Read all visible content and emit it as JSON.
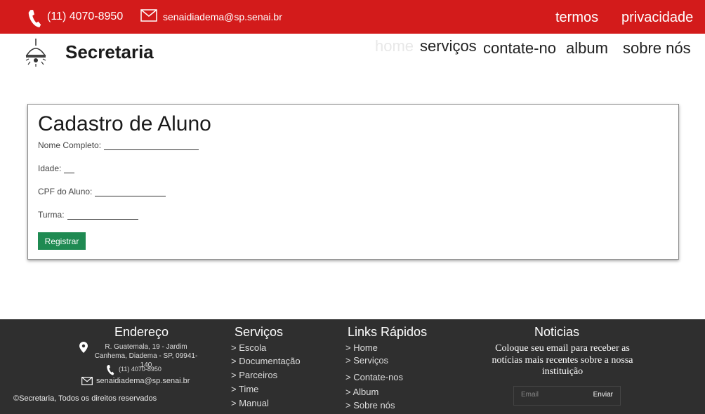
{
  "topbar": {
    "phone": "(11) 4070-8950",
    "email": "senaidiadema@sp.senai.br",
    "links": [
      "termos",
      "privacidade"
    ]
  },
  "brand": {
    "name": "Secretaria"
  },
  "nav": [
    "home",
    "serviços",
    "contate-no",
    "album",
    "sobre nós"
  ],
  "form": {
    "title": "Cadastro de Aluno",
    "fields": [
      "Nome Completo:",
      "Idade:",
      "CPF do Aluno:",
      "Turma:"
    ],
    "submit": "Registrar"
  },
  "footer": {
    "endereco": {
      "title": "Endereço",
      "address": "R. Guatemala, 19 - Jardim Canhema, Diadema - SP, 09941-140",
      "phone": "(11) 4070-8950",
      "email": "senaidiadema@sp.senai.br"
    },
    "servicos": {
      "title": "Serviços",
      "items": [
        "> Escola",
        "> Documentação",
        "> Parceiros",
        "> Time",
        "> Manual"
      ]
    },
    "links": {
      "title": "Links Rápidos",
      "items": [
        "> Home",
        "> Serviços",
        "> Contate-nos",
        "> Album",
        "> Sobre nós"
      ]
    },
    "noticias": {
      "title": "Noticias",
      "text": "Coloque seu email para receber as notícias mais recentes sobre a nossa instituição",
      "placeholder": "Email",
      "button": "Enviar"
    },
    "copyright": "©Secretaria, Todos os direitos reservados"
  },
  "colors": {
    "topbar": "#d31b1b",
    "footer": "#2f2f2f",
    "button": "#1f8a52"
  }
}
